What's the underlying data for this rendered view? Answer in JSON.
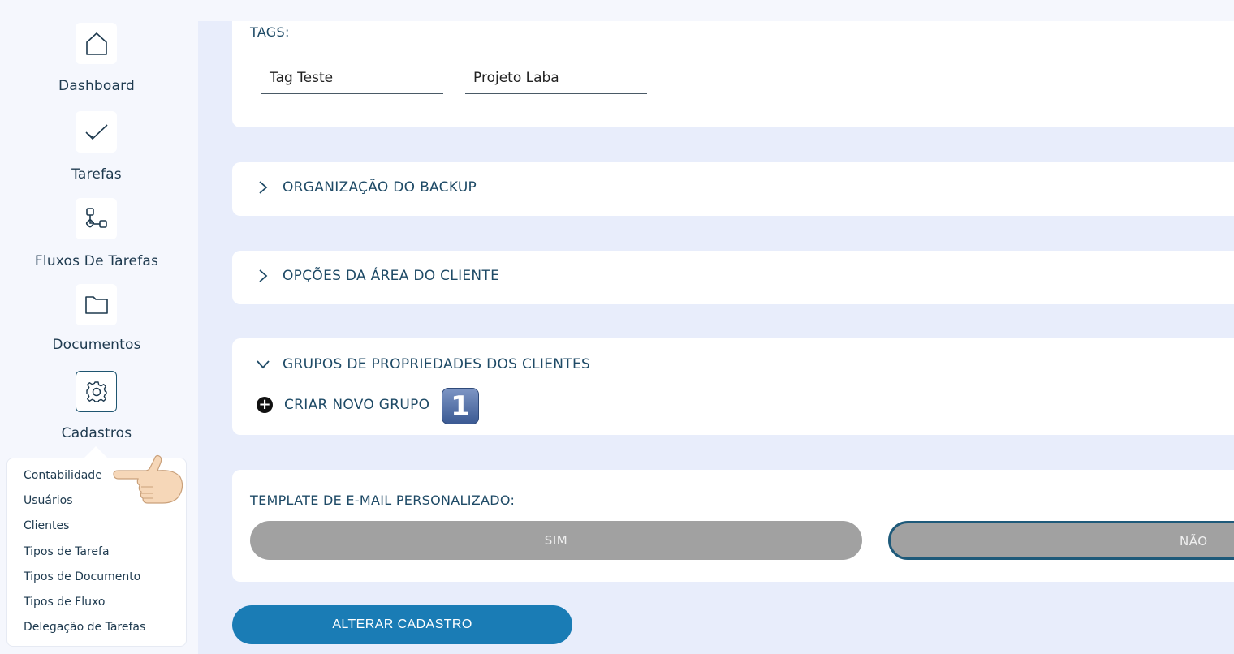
{
  "sidebar": {
    "items": [
      {
        "label": "Dashboard",
        "icon": "home-icon"
      },
      {
        "label": "Tarefas",
        "icon": "check-icon"
      },
      {
        "label": "Fluxos De Tarefas",
        "icon": "workflow-icon"
      },
      {
        "label": "Documentos",
        "icon": "folder-icon"
      },
      {
        "label": "Cadastros",
        "icon": "gear-icon",
        "active": true
      }
    ],
    "submenu": [
      "Contabilidade",
      "Usuários",
      "Clientes",
      "Tipos de Tarefa",
      "Tipos de Documento",
      "Tipos de Fluxo",
      "Delegação de Tarefas"
    ]
  },
  "tags": {
    "label": "TAGS:",
    "values": [
      "Tag Teste",
      "Projeto Laba"
    ]
  },
  "sections": {
    "backup": "ORGANIZAÇÃO DO BACKUP",
    "client_area": "OPÇÕES DA ÁREA DO CLIENTE",
    "property_groups": "GRUPOS DE PROPRIEDADES DOS CLIENTES"
  },
  "property_groups": {
    "create_label": "CRIAR NOVO GRUPO",
    "step_badge": "1"
  },
  "email_template": {
    "label": "TEMPLATE DE E-MAIL PERSONALIZADO:",
    "yes": "SIM",
    "no": "NÃO",
    "selected": "NÃO"
  },
  "submit_label": "ALTERAR CADASTRO",
  "colors": {
    "primary": "#1a7cb5",
    "toggle": "#a1a1a1",
    "background": "#e8edfb"
  }
}
